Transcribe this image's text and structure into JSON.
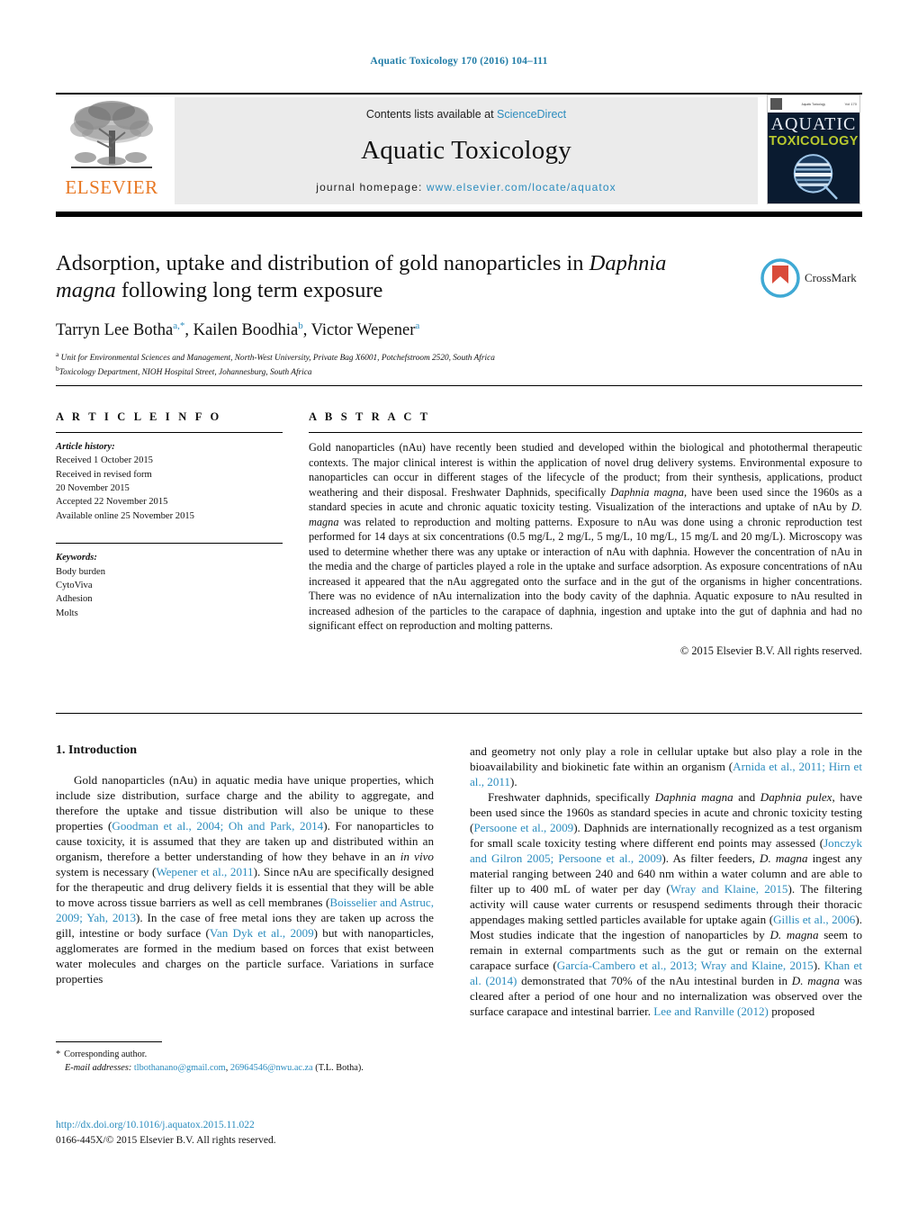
{
  "running_head": "Aquatic Toxicology 170 (2016) 104–111",
  "masthead": {
    "publisher_logo_text": "ELSEVIER",
    "contents_prefix": "Contents lists available at",
    "contents_link": "ScienceDirect",
    "journal_title": "Aquatic Toxicology",
    "homepage_prefix": "journal homepage:",
    "homepage_url": "www.elsevier.com/locate/aquatox",
    "cover": {
      "line1": "AQUATIC",
      "line2": "TOXICOLOGY",
      "top_center": "Aquatic Toxicology",
      "top_right": "Vol 170",
      "accent_color": "#b9c92e",
      "bg_color": "#0a1b30"
    },
    "link_color": "#2b8cbe",
    "band_color": "#ebebeb"
  },
  "article": {
    "title_part1": "Adsorption, uptake and distribution of gold nanoparticles in ",
    "title_italic": "Daphnia magna",
    "title_part2": " following long term exposure",
    "authors_html": "Tarryn Lee Botha^a,*, Kailen Boodhia^b, Victor Wepener^a",
    "authors": [
      {
        "name": "Tarryn Lee Botha",
        "marks": "a,*"
      },
      {
        "name": "Kailen Boodhia",
        "marks": "b"
      },
      {
        "name": "Victor Wepener",
        "marks": "a"
      }
    ],
    "affiliations": [
      {
        "mark": "a",
        "text": "Unit for Environmental Sciences and Management, North-West University, Private Bag X6001, Potchefstroom 2520, South Africa"
      },
      {
        "mark": "b",
        "text": "Toxicology Department, NIOH Hospital Street, Johannesburg, South Africa"
      }
    ],
    "crossmark_label": "CrossMark"
  },
  "article_info": {
    "heading": "A R T I C L E   I N F O",
    "history_label": "Article history:",
    "history": [
      "Received 1 October 2015",
      "Received in revised form",
      "20 November 2015",
      "Accepted 22 November 2015",
      "Available online 25 November 2015"
    ],
    "keywords_label": "Keywords:",
    "keywords": [
      "Body burden",
      "CytoViva",
      "Adhesion",
      "Molts"
    ]
  },
  "abstract": {
    "heading": "A B S T R A C T",
    "paragraph_1": "Gold nanoparticles (nAu) have recently been studied and developed within the biological and photothermal therapeutic contexts. The major clinical interest is within the application of novel drug delivery systems. Environmental exposure to nanoparticles can occur in different stages of the lifecycle of the product; from their synthesis, applications, product weathering and their disposal. Freshwater Daphnids, specifically ",
    "italic_1": "Daphnia magna",
    "paragraph_2": ", have been used since the 1960s as a standard species in acute and chronic aquatic toxicity testing. Visualization of the interactions and uptake of nAu by ",
    "italic_2": "D. magna",
    "paragraph_3": " was related to reproduction and molting patterns. Exposure to nAu was done using a chronic reproduction test performed for 14 days at six concentrations (0.5 mg/L, 2 mg/L, 5 mg/L, 10 mg/L, 15 mg/L and 20 mg/L). Microscopy was used to determine whether there was any uptake or interaction of nAu with daphnia. However the concentration of nAu in the media and the charge of particles played a role in the uptake and surface adsorption. As exposure concentrations of nAu increased it appeared that the nAu aggregated onto the surface and in the gut of the organisms in higher concentrations. There was no evidence of nAu internalization into the body cavity of the daphnia. Aquatic exposure to nAu resulted in increased adhesion of the particles to the carapace of daphnia, ingestion and uptake into the gut of daphnia and had no significant effect on reproduction and molting patterns.",
    "copyright": "© 2015 Elsevier B.V. All rights reserved."
  },
  "body": {
    "section_number_title": "1.  Introduction",
    "left_paragraph": {
      "t1": "Gold nanoparticles (nAu) in aquatic media have unique properties, which include size distribution, surface charge and the ability to aggregate, and therefore the uptake and tissue distribution will also be unique to these properties (",
      "c1": "Goodman et al., 2004; Oh and Park, 2014",
      "t2": "). For nanoparticles to cause toxicity, it is assumed that they are taken up and distributed within an organism, therefore a better understanding of how they behave in an ",
      "i1": "in vivo",
      "t3": " system is necessary (",
      "c2": "Wepener et al., 2011",
      "t4": "). Since nAu are specifically designed for the therapeutic and drug delivery fields it is essential that they will be able to move across tissue barriers as well as cell membranes (",
      "c3": "Boisselier and Astruc, 2009; Yah, 2013",
      "t5": "). In the case of free metal ions they are taken up across the gill, intestine or body surface (",
      "c4": "Van Dyk et al., 2009",
      "t6": ") but with nanoparticles, agglomerates are formed in the medium based on forces that exist between water molecules and charges on the particle surface. Variations in surface properties"
    },
    "right_paragraph_1": {
      "t1": "and geometry not only play a role in cellular uptake but also play a role in the bioavailability and biokinetic fate within an organism (",
      "c1": "Arnida et al., 2011; Hirn et al., 2011",
      "t2": ")."
    },
    "right_paragraph_2": {
      "t1": "Freshwater daphnids, specifically ",
      "i1": "Daphnia magna",
      "t2": " and ",
      "i2": "Daphnia pulex",
      "t3": ", have been used since the 1960s as standard species in acute and chronic toxicity testing (",
      "c1": "Persoone et al., 2009",
      "t4": "). Daphnids are internationally recognized as a test organism for small scale toxicity testing where different end points may assessed (",
      "c2": "Jonczyk and Gilron 2005; Persoone et al., 2009",
      "t5": "). As filter feeders, ",
      "i3": "D. magna",
      "t6": " ingest any material ranging between 240 and 640 nm within a water column and are able to filter up to 400 mL of water per day (",
      "c3": "Wray and Klaine, 2015",
      "t7": "). The filtering activity will cause water currents or resuspend sediments through their thoracic appendages making settled particles available for uptake again (",
      "c4": "Gillis et al., 2006",
      "t8": "). Most studies indicate that the ingestion of nanoparticles by ",
      "i4": "D. magna",
      "t9": " seem to remain in external compartments such as the gut or remain on the external carapace surface (",
      "c5": "García-Cambero et al., 2013; Wray and Klaine, 2015",
      "t10": "). ",
      "c6": "Khan et al. (2014)",
      "t11": " demonstrated that 70% of the nAu intestinal burden in ",
      "i5": "D. magna",
      "t12": " was cleared after a period of one hour and no internalization was observed over the surface carapace and intestinal barrier. ",
      "c7": "Lee and Ranville (2012)",
      "t13": " proposed"
    }
  },
  "footnote": {
    "star": "*",
    "corresponding": "Corresponding author.",
    "email_label": "E-mail addresses:",
    "email_1": "tlbothanano@gmail.com",
    "email_sep": ", ",
    "email_2": "26964546@nwu.ac.za",
    "email_owner": " (T.L. Botha)."
  },
  "footer": {
    "doi": "http://dx.doi.org/10.1016/j.aquatox.2015.11.022",
    "issn_line": "0166-445X/© 2015 Elsevier B.V. All rights reserved."
  },
  "colors": {
    "link": "#2b8cbe",
    "elsevier_orange": "#E87722",
    "cover_yellow": "#b9c92e"
  }
}
